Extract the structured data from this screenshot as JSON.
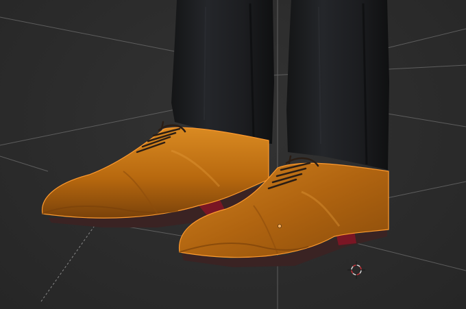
{
  "viewport": {
    "background_color": "#2c2c2c",
    "grid_color": "#6f6f6f",
    "selection_outline_color": "#ff9a2e"
  },
  "model": {
    "trousers_color": "#1b1c1e",
    "shoe_color": "#b8690f",
    "shoe_highlight_color": "#d98a22",
    "sole_color": "#3a2323",
    "heel_color": "#7a1624",
    "lace_color": "#2a1d14"
  },
  "icons": {
    "cursor": "3d-cursor-icon",
    "origin": "object-origin-icon"
  }
}
